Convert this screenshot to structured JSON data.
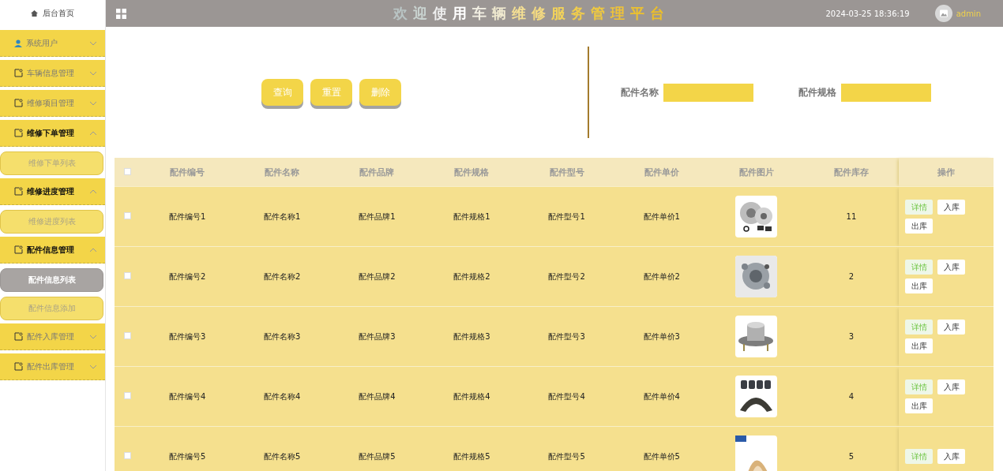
{
  "sidebar": {
    "home": "后台首页",
    "menu": [
      {
        "label": "系统用户",
        "kind": "user",
        "expanded": false
      },
      {
        "label": "车辆信息管理",
        "kind": "module",
        "expanded": false
      },
      {
        "label": "维修项目管理",
        "kind": "module",
        "expanded": false
      },
      {
        "label": "维修下单管理",
        "kind": "module",
        "expanded": true,
        "children": [
          {
            "label": "维修下单列表",
            "selected": false
          }
        ]
      },
      {
        "label": "维修进度管理",
        "kind": "module",
        "expanded": true,
        "children": [
          {
            "label": "维修进度列表",
            "selected": false
          }
        ]
      },
      {
        "label": "配件信息管理",
        "kind": "module",
        "expanded": true,
        "children": [
          {
            "label": "配件信息列表",
            "selected": true
          },
          {
            "label": "配件信息添加",
            "selected": false
          }
        ]
      },
      {
        "label": "配件入库管理",
        "kind": "module",
        "expanded": false
      },
      {
        "label": "配件出库管理",
        "kind": "module",
        "expanded": false
      }
    ]
  },
  "header": {
    "title": "欢迎使用车辆维修服务管理平台",
    "datetime": "2024-03-25 18:36:19",
    "user": "admin"
  },
  "search": {
    "buttons": [
      "查询",
      "重置",
      "删除"
    ],
    "fields": [
      {
        "label": "配件名称"
      },
      {
        "label": "配件规格"
      }
    ]
  },
  "table": {
    "select_all_checked": false,
    "columns": [
      "配件编号",
      "配件名称",
      "配件品牌",
      "配件规格",
      "配件型号",
      "配件单价",
      "配件图片",
      "配件库存",
      "操作"
    ],
    "rows": [
      {
        "checked": false,
        "cells": [
          "配件编号1",
          "配件名称1",
          "配件品牌1",
          "配件规格1",
          "配件型号1",
          "配件单价1"
        ],
        "stock": "11",
        "actions": [
          "详情",
          "入库",
          "出库"
        ]
      },
      {
        "checked": false,
        "cells": [
          "配件编号2",
          "配件名称2",
          "配件品牌2",
          "配件规格2",
          "配件型号2",
          "配件单价2"
        ],
        "stock": "2",
        "actions": [
          "详情",
          "入库",
          "出库"
        ]
      },
      {
        "checked": false,
        "cells": [
          "配件编号3",
          "配件名称3",
          "配件品牌3",
          "配件规格3",
          "配件型号3",
          "配件单价3"
        ],
        "stock": "3",
        "actions": [
          "详情",
          "入库",
          "出库"
        ]
      },
      {
        "checked": false,
        "cells": [
          "配件编号4",
          "配件名称4",
          "配件品牌4",
          "配件规格4",
          "配件型号4",
          "配件单价4"
        ],
        "stock": "4",
        "actions": [
          "详情",
          "入库",
          "出库"
        ]
      },
      {
        "checked": false,
        "cells": [
          "配件编号5",
          "配件名称5",
          "配件品牌5",
          "配件规格5",
          "配件型号5",
          "配件单价5"
        ],
        "stock": "5",
        "actions": [
          "详情",
          "入库"
        ]
      }
    ]
  }
}
